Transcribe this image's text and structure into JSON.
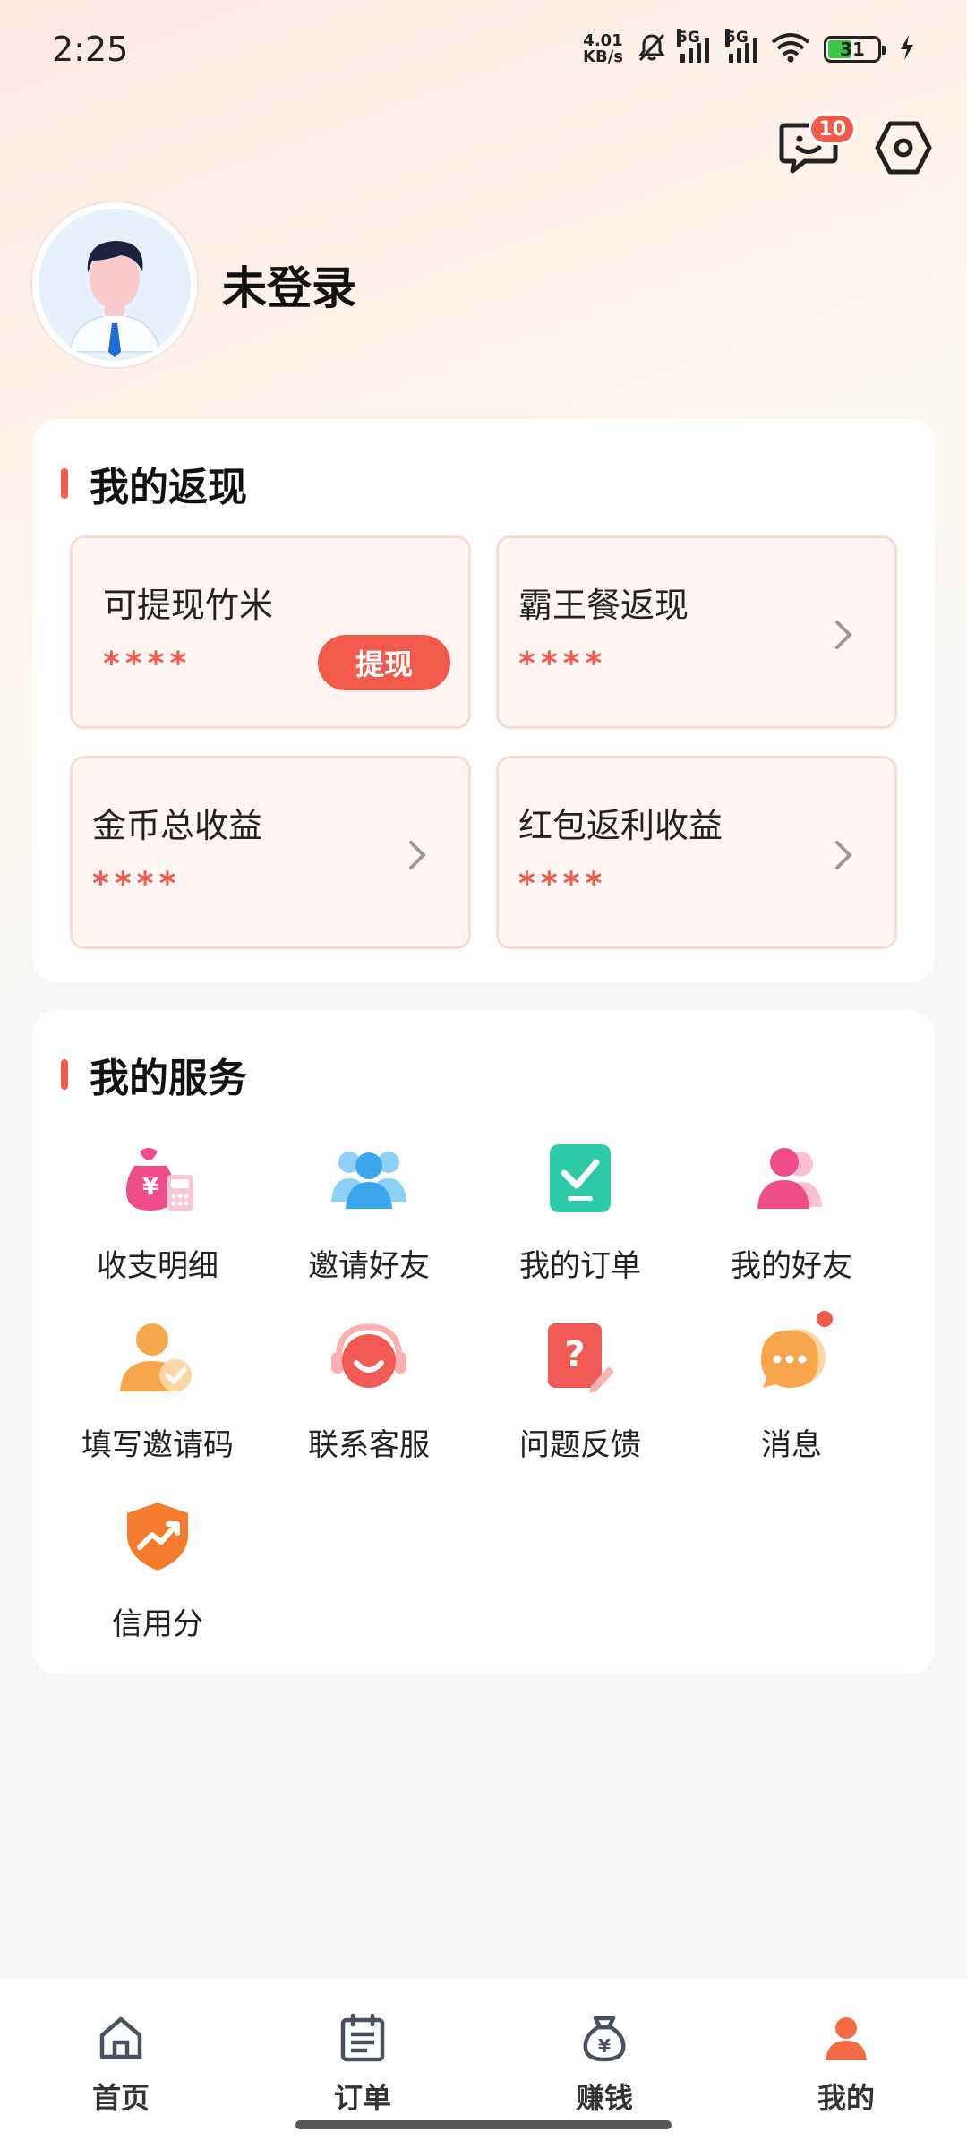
{
  "status_bar": {
    "time": "2:25",
    "net_speed_value": "4.01",
    "net_speed_unit": "KB/s",
    "signal1_tag": "5G",
    "signal2_tag": "5G",
    "battery": "31"
  },
  "header": {
    "message_badge": "10"
  },
  "profile": {
    "name": "未登录"
  },
  "cashback": {
    "title": "我的返现",
    "tiles": [
      {
        "label": "可提现竹米",
        "value": "****",
        "button": "提现"
      },
      {
        "label": "霸王餐返现",
        "value": "****"
      },
      {
        "label": "金币总收益",
        "value": "****"
      },
      {
        "label": "红包返利收益",
        "value": "****"
      }
    ]
  },
  "services": {
    "title": "我的服务",
    "items": [
      {
        "label": "收支明细",
        "icon": "money-bag-icon"
      },
      {
        "label": "邀请好友",
        "icon": "invite-friends-icon"
      },
      {
        "label": "我的订单",
        "icon": "order-check-icon"
      },
      {
        "label": "我的好友",
        "icon": "friends-icon"
      },
      {
        "label": "填写邀请码",
        "icon": "invite-code-icon"
      },
      {
        "label": "联系客服",
        "icon": "customer-service-icon"
      },
      {
        "label": "问题反馈",
        "icon": "feedback-icon"
      },
      {
        "label": "消息",
        "icon": "message-icon"
      },
      {
        "label": "信用分",
        "icon": "credit-score-icon"
      }
    ]
  },
  "tabbar": {
    "tabs": [
      {
        "label": "首页",
        "icon": "home-icon"
      },
      {
        "label": "订单",
        "icon": "orders-icon"
      },
      {
        "label": "赚钱",
        "icon": "earn-icon"
      },
      {
        "label": "我的",
        "icon": "profile-icon"
      }
    ],
    "active_color": "#f26b45"
  },
  "colors": {
    "accent": "#f25a4b",
    "tile_bg": "#fff6f4",
    "tile_border": "#fadad5"
  }
}
